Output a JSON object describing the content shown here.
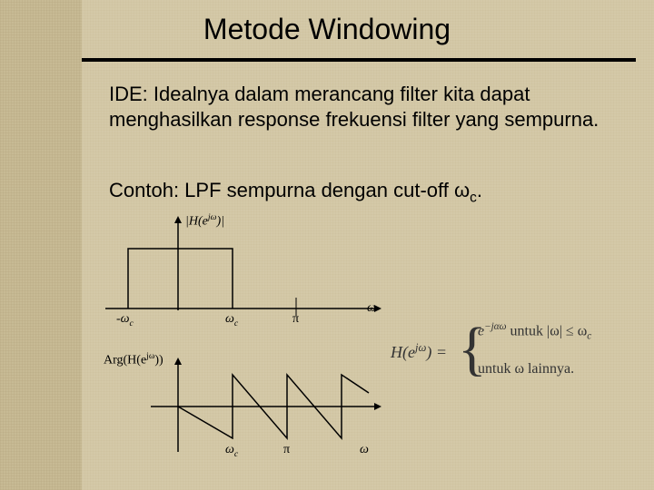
{
  "title": "Metode Windowing",
  "para1": "IDE: Idealnya dalam merancang filter kita dapat menghasilkan response frekuensi filter yang sempurna.",
  "para2_prefix": "Contoh: LPF sempurna dengan cut-off ",
  "para2_cutoff": "ω",
  "para2_cutoff_sub": "c",
  "para2_suffix": ".",
  "graph1": {
    "ylabel": "|H(e",
    "ylabel_sup": "jω",
    "ylabel_suffix": ")|",
    "neg_wc": "-ω",
    "wc": "ω",
    "wc_sub": "c",
    "pi": "π",
    "omega": "ω"
  },
  "graph2": {
    "ylabel": "Arg(H(e",
    "ylabel_sup": "jω",
    "ylabel_suffix": "))",
    "wc": "ω",
    "wc_sub": "c",
    "pi": "π",
    "omega": "ω"
  },
  "formula": {
    "lhs_prefix": "H(e",
    "lhs_sup": "jω",
    "lhs_suffix": ") =",
    "case1_prefix": "e",
    "case1_sup": "−jαω",
    "case1_cond_prefix": "  untuk |ω| ≤ ω",
    "case1_cond_sub": "c",
    "case2": "untuk ω lainnya."
  },
  "chart_data": [
    {
      "type": "line",
      "title": "|H(e^{jω})|",
      "xlabel": "ω",
      "ylabel": "|H(e^{jω})|",
      "xlim": [
        -1.6,
        3.3
      ],
      "ylim": [
        0,
        1.2
      ],
      "x_ticks": [
        -1,
        1,
        3.14
      ],
      "x_ticklabels": [
        "-ω_c",
        "ω_c",
        "π"
      ],
      "series": [
        {
          "name": "magnitude",
          "x": [
            -1.6,
            -1,
            -1,
            1,
            1,
            3.3
          ],
          "y": [
            0,
            0,
            1,
            1,
            0,
            0
          ]
        }
      ]
    },
    {
      "type": "line",
      "title": "Arg(H(e^{jω}))",
      "xlabel": "ω",
      "ylabel": "Arg(H(e^{jω}))",
      "xlim": [
        0,
        3.3
      ],
      "ylim": [
        -1,
        1
      ],
      "x_ticks": [
        1,
        3.14
      ],
      "x_ticklabels": [
        "ω_c",
        "π"
      ],
      "series": [
        {
          "name": "phase",
          "x": [
            0,
            1,
            1,
            2,
            2,
            3,
            3,
            3.3
          ],
          "y": [
            0,
            -1,
            1,
            -1,
            1,
            -1,
            1,
            0.7
          ]
        }
      ]
    }
  ]
}
